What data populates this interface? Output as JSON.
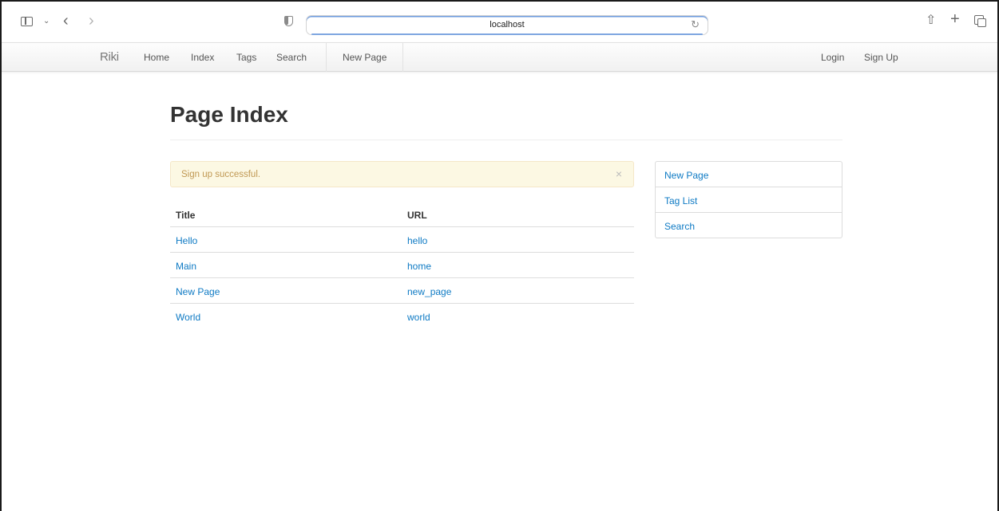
{
  "browser": {
    "address": "localhost",
    "icons": [
      "sidebar-toggle-icon",
      "chevron-down-icon",
      "back-icon",
      "forward-icon",
      "shield-icon",
      "reload-icon",
      "share-icon",
      "new-tab-icon",
      "tabs-overview-icon"
    ],
    "accent": "#6d9bdf"
  },
  "navbar": {
    "brand": "Riki",
    "links": [
      "Home",
      "Index",
      "Tags",
      "Search",
      "New Page"
    ],
    "right_links": [
      "Login",
      "Sign Up"
    ]
  },
  "page": {
    "title": "Page Index"
  },
  "alert": {
    "text": "Sign up successful.",
    "close": "×",
    "bg_color": "#fcf8e3",
    "text_color": "#c09853"
  },
  "table": {
    "headers": [
      "Title",
      "URL"
    ],
    "rows": [
      [
        "Hello",
        "hello"
      ],
      [
        "Main",
        "home"
      ],
      [
        "New Page",
        "new_page"
      ],
      [
        "World",
        "world"
      ]
    ],
    "link_color": "#0e7ac4"
  },
  "sidebar": {
    "items": [
      "New Page",
      "Tag List",
      "Search"
    ]
  }
}
